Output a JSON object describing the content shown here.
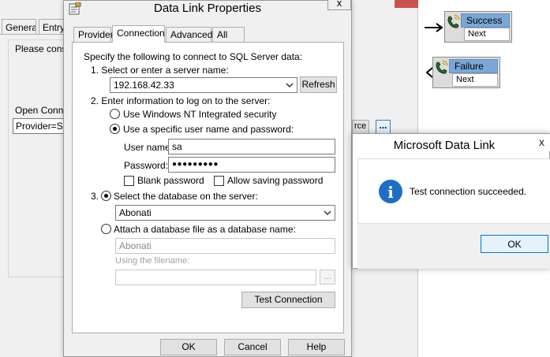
{
  "background_dialog": {
    "tabs": [
      "General",
      "Entry"
    ],
    "please_text": "Please cons",
    "open_conn_label": "Open Conne",
    "provider_value": "Provider=SQ",
    "source_button_label": "rce",
    "dots_button_label": "..."
  },
  "workflow": {
    "success_node": {
      "title": "Success",
      "sub": "Next"
    },
    "failure_node": {
      "title": "Failure",
      "sub": "Next"
    }
  },
  "data_link": {
    "title": "Data Link Properties",
    "close_label": "x",
    "tabs": [
      "Provider",
      "Connection",
      "Advanced",
      "All"
    ],
    "active_tab": "Connection",
    "intro": "Specify the following to connect to SQL Server data:",
    "step1_label": "1. Select or enter a server name:",
    "server_name": "192.168.42.33",
    "refresh_label": "Refresh",
    "step2_label": "2. Enter information to log on to the server:",
    "radio_nt": "Use Windows NT Integrated security",
    "radio_specific": "Use a specific user name and password:",
    "username_label": "User name:",
    "username_value": "sa",
    "password_label": "Password:",
    "password_value": "●●●●●●●●●",
    "blank_password_label": "Blank password",
    "allow_saving_label": "Allow saving password",
    "step3_label": "3.",
    "radio_select_db": "Select the database on the server:",
    "database_value": "Abonati",
    "radio_attach": "Attach a database file as a database name:",
    "attach_value": "Abonati",
    "filename_label": "Using the filename:",
    "browse_label": "...",
    "test_connection_label": "Test Connection",
    "ok_label": "OK",
    "cancel_label": "Cancel",
    "help_label": "Help"
  },
  "message_box": {
    "title": "Microsoft Data Link",
    "close_label": "x",
    "message": "Test connection succeeded.",
    "ok_label": "OK",
    "info_glyph": "i"
  },
  "colors": {
    "dialog_bg": "#f0f0f0",
    "info_blue": "#1e6fc4",
    "node_title_bg": "#7aa7d6",
    "close_red": "#c75050",
    "focus_blue": "#0078d7"
  }
}
